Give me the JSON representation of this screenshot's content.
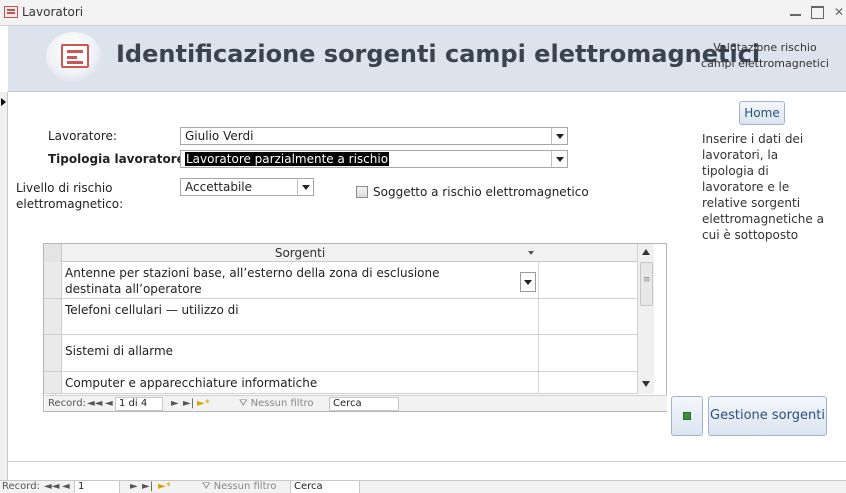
{
  "window": {
    "title": "Lavoratori",
    "controls": {
      "minimize": "",
      "maximize": "",
      "close": "✕"
    }
  },
  "header": {
    "title": "Identificazione sorgenti campi elettromagnetici",
    "side_line1": "Valutazione rischio",
    "side_line2": "campi elettromagnetici"
  },
  "form": {
    "lavoratore_label": "Lavoratore:",
    "lavoratore_value": "Giulio Verdi",
    "tipologia_label": "Tipologia lavoratore:",
    "tipologia_value": "Lavoratore parzialmente a rischio",
    "livello_label_line1": "Livello di rischio",
    "livello_label_line2": "elettromagnetico:",
    "livello_value": "Accettabile",
    "soggetto_label": "Soggetto a rischio elettromagnetico",
    "soggetto_checked": false
  },
  "sidebar": {
    "home_label": "Home",
    "help_text": "Inserire i dati dei lavoratori, la tipologia di lavoratore e le relative sorgenti elettromagnetiche a cui è sottoposto"
  },
  "subform": {
    "column_header": "Sorgenti",
    "rows": [
      {
        "line1": "Antenne per stazioni base, all’esterno della zona di esclusione",
        "line2": "destinata all’operatore"
      },
      {
        "line1": "Telefoni cellulari — utilizzo di",
        "line2": ""
      },
      {
        "line1": "Sistemi di allarme",
        "line2": ""
      },
      {
        "line1": "Computer e apparecchiature informatiche",
        "line2": ""
      }
    ],
    "nav": {
      "record_label": "Record:",
      "first": "◄◄",
      "prev": "◄",
      "position": "1 di 4",
      "next": "►",
      "last": "►|",
      "new": "►*",
      "filter": "Nessun filtro",
      "search": "Cerca"
    }
  },
  "actions": {
    "gestione_label": "Gestione sorgenti"
  },
  "main_nav": {
    "record_label": "Record:",
    "first": "◄◄",
    "prev": "◄",
    "position": "1",
    "next": "►",
    "last": "►|",
    "new": "►*",
    "filter": "Nessun filtro",
    "search": "Cerca"
  }
}
